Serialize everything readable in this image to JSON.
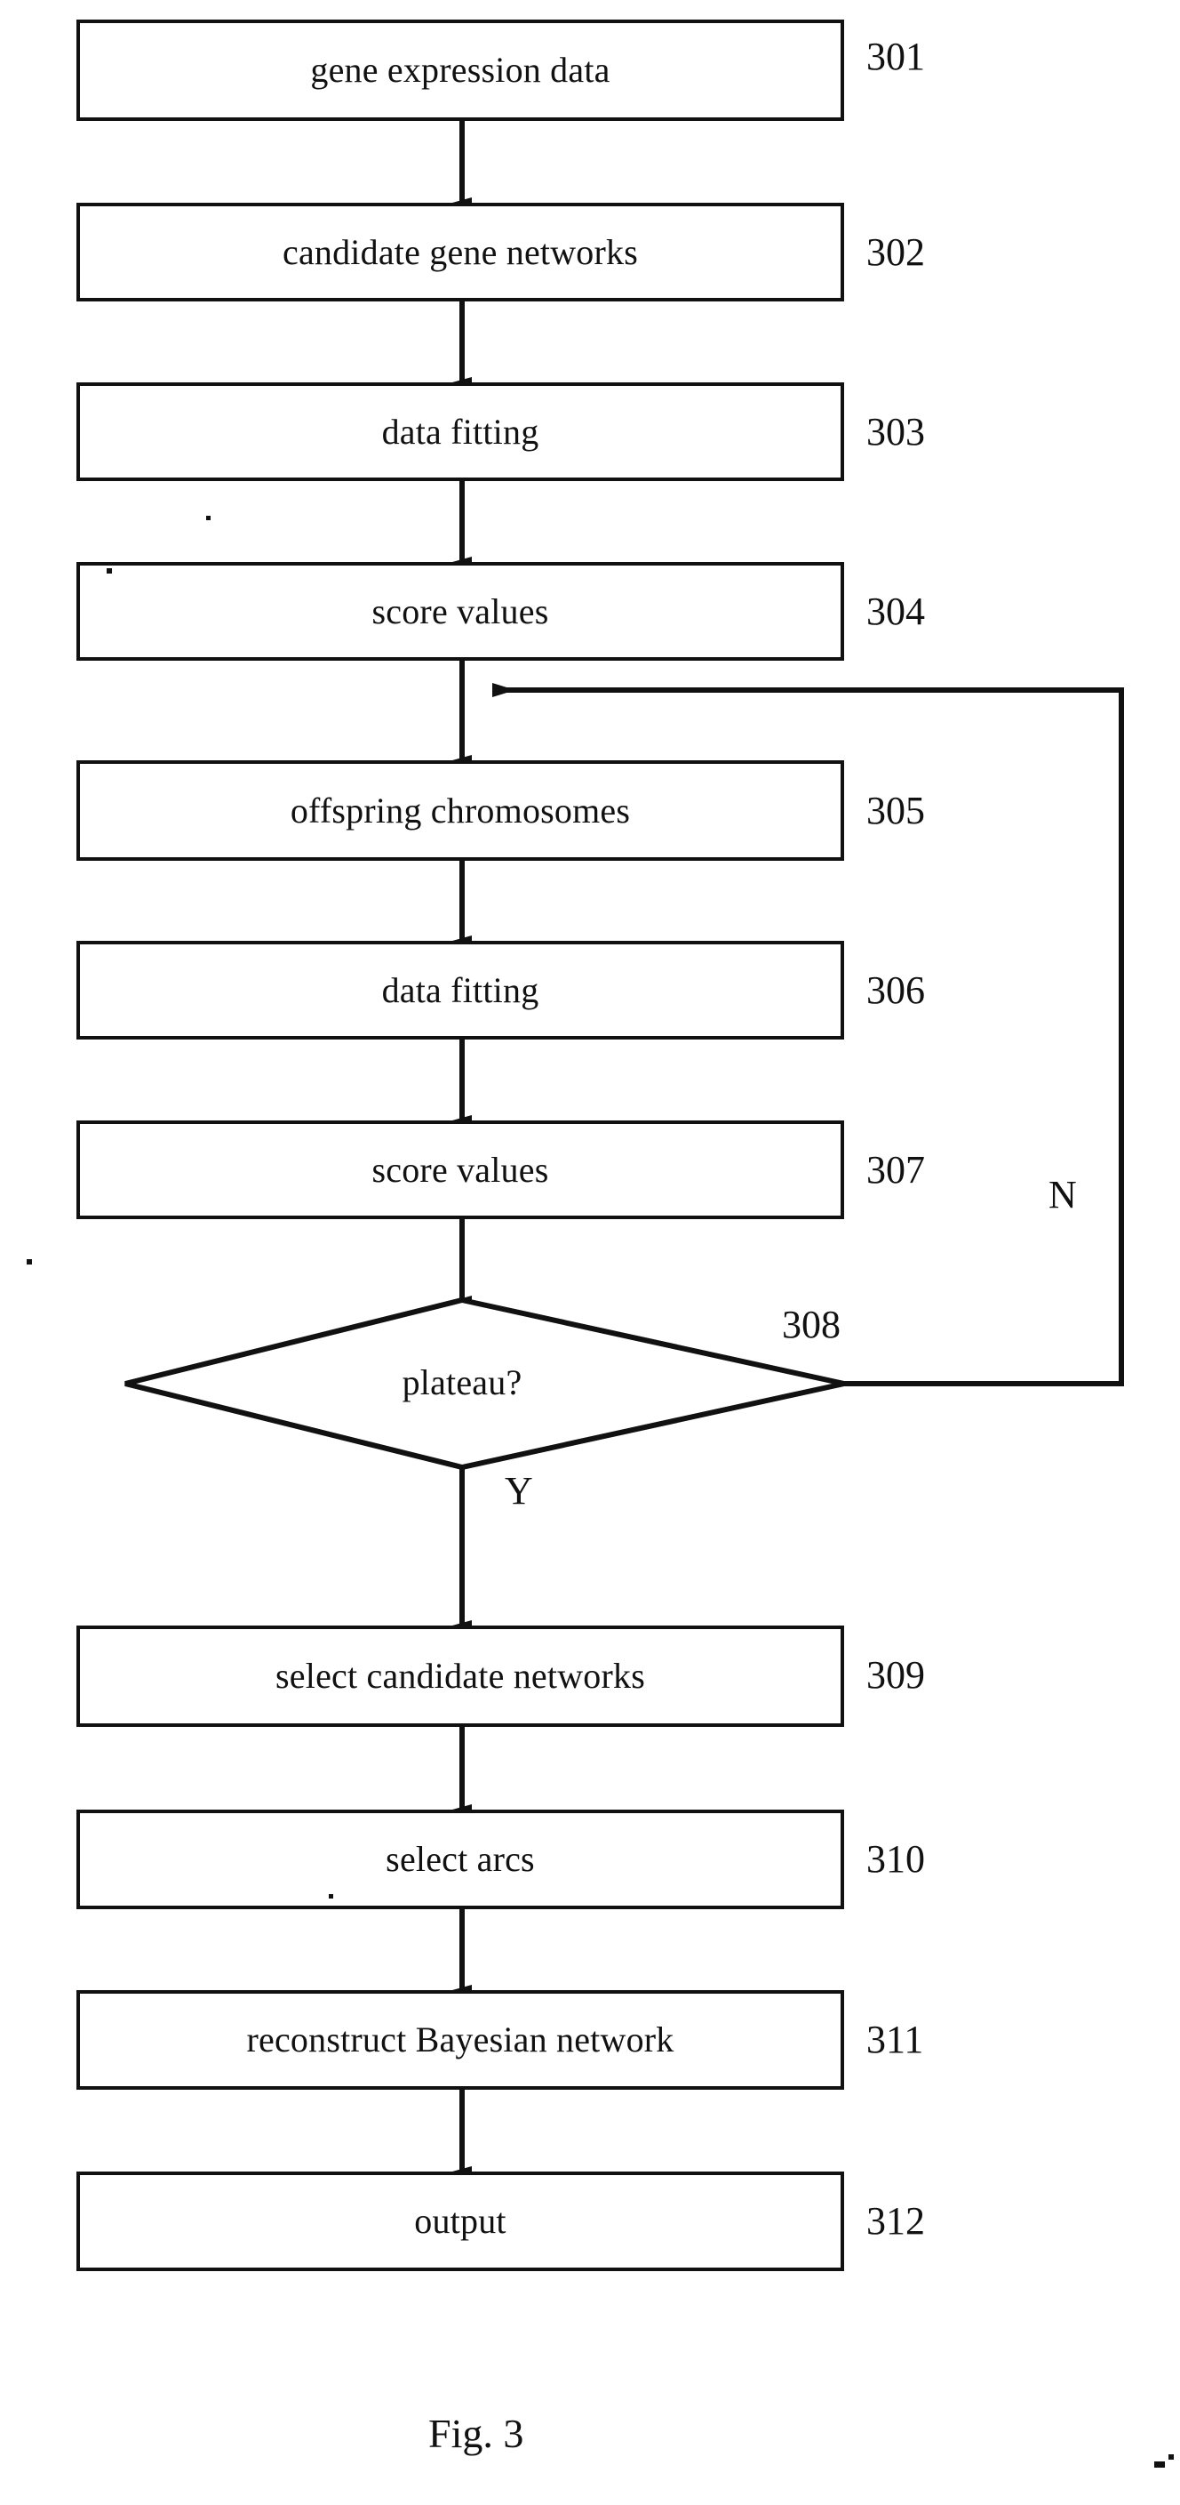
{
  "figure": {
    "caption": "Fig. 3",
    "nodes": [
      {
        "id": "301",
        "label": "gene expression data",
        "shape": "process"
      },
      {
        "id": "302",
        "label": "candidate gene networks",
        "shape": "process"
      },
      {
        "id": "303",
        "label": "data fitting",
        "shape": "process"
      },
      {
        "id": "304",
        "label": "score values",
        "shape": "process"
      },
      {
        "id": "305",
        "label": "offspring chromosomes",
        "shape": "process"
      },
      {
        "id": "306",
        "label": "data fitting",
        "shape": "process"
      },
      {
        "id": "307",
        "label": "score values",
        "shape": "process"
      },
      {
        "id": "308",
        "label": "plateau?",
        "shape": "decision"
      },
      {
        "id": "309",
        "label": "select candidate networks",
        "shape": "process"
      },
      {
        "id": "310",
        "label": "select arcs",
        "shape": "process"
      },
      {
        "id": "311",
        "label": "reconstruct Bayesian network",
        "shape": "process"
      },
      {
        "id": "312",
        "label": "output",
        "shape": "process"
      }
    ],
    "branch_labels": {
      "no": "N",
      "yes": "Y"
    },
    "colors": {
      "line": "#111111",
      "background": "#ffffff"
    }
  }
}
